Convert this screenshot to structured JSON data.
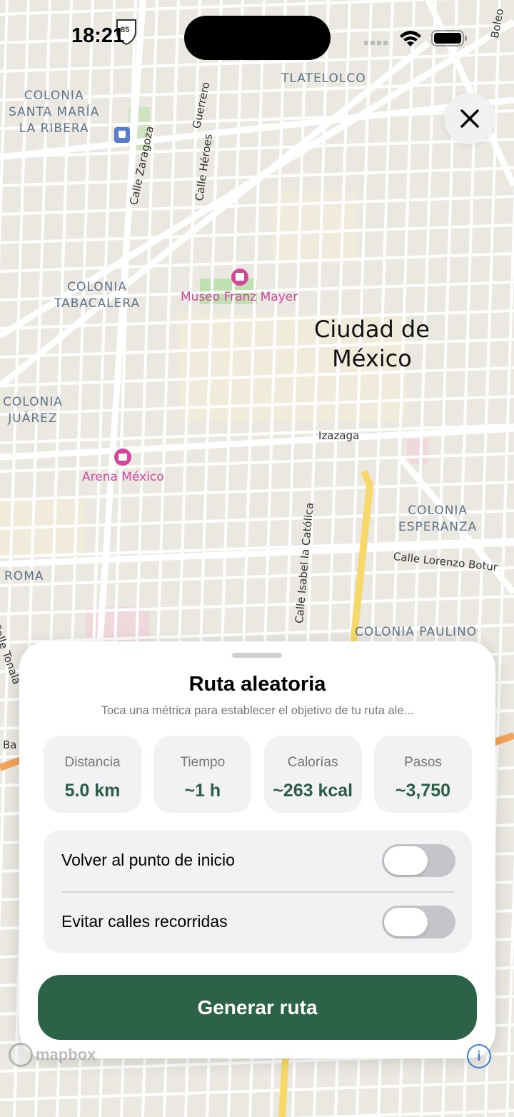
{
  "status_bar": {
    "time": "18:21",
    "highway_shield": "85"
  },
  "map": {
    "neighborhoods": [
      {
        "id": "santa-maria",
        "lines": [
          "COLONIA",
          "SANTA MARÍA",
          "LA RIBERA"
        ]
      },
      {
        "id": "tlatelolco",
        "lines": [
          "TLATELOLCO"
        ]
      },
      {
        "id": "tabacalera",
        "lines": [
          "COLONIA",
          "TABACALERA"
        ]
      },
      {
        "id": "juarez",
        "lines": [
          "COLONIA",
          "JUÁREZ"
        ]
      },
      {
        "id": "esperanza",
        "lines": [
          "COLONIA",
          "ESPERANZA"
        ]
      },
      {
        "id": "roma",
        "lines": [
          "ROMA"
        ]
      },
      {
        "id": "paulino",
        "lines": [
          "COLONIA PAULINO"
        ]
      }
    ],
    "streets": {
      "zaragoza": "Calle Zaragoza",
      "heroes": "Calle Héroes",
      "guerrero": "Guerrero",
      "izazaga": "Izazaga",
      "isabel": "Calle Isabel la Católica",
      "lorenzo": "Calle Lorenzo Botur",
      "tonala": "Calle Tonalá",
      "boleo": "Boleo",
      "ba": "Ba"
    },
    "pois": {
      "museo": "Museo Franz Mayer",
      "arena": "Arena México"
    },
    "city": [
      "Ciudad de",
      "México"
    ]
  },
  "sheet": {
    "title": "Ruta aleatoria",
    "subtitle": "Toca una métrica para establecer el objetivo de tu ruta ale...",
    "metrics": [
      {
        "label": "Distancia",
        "value": "5.0 km"
      },
      {
        "label": "Tiempo",
        "value": "~1 h"
      },
      {
        "label": "Calorías",
        "value": "~263 kcal"
      },
      {
        "label": "Pasos",
        "value": "~3,750"
      }
    ],
    "options": [
      {
        "label": "Volver al punto de inicio",
        "enabled": false
      },
      {
        "label": "Evitar calles recorridas",
        "enabled": false
      }
    ],
    "generate_label": "Generar ruta"
  },
  "attribution": {
    "logo": "mapbox",
    "info": "i"
  },
  "colors": {
    "accent": "#2c6248",
    "metric_value": "#2c5e46",
    "poi": "#d2479a"
  }
}
